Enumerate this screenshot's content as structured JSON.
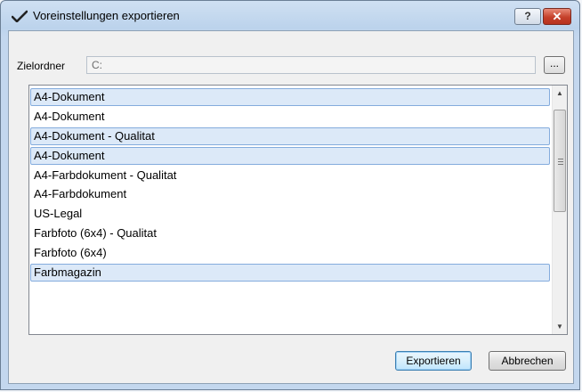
{
  "window": {
    "title": "Voreinstellungen exportieren",
    "help_label": "?",
    "close_label": "✕"
  },
  "folder": {
    "label": "Zielordner",
    "value": "C:",
    "browse_label": "..."
  },
  "presets": [
    {
      "label": "A4-Dokument",
      "selected": true
    },
    {
      "label": "A4-Dokument",
      "selected": false
    },
    {
      "label": "A4-Dokument - Qualitat",
      "selected": true
    },
    {
      "label": "A4-Dokument",
      "selected": true
    },
    {
      "label": "A4-Farbdokument - Qualitat",
      "selected": false
    },
    {
      "label": "A4-Farbdokument",
      "selected": false
    },
    {
      "label": "US-Legal",
      "selected": false
    },
    {
      "label": "Farbfoto (6x4) - Qualitat",
      "selected": false
    },
    {
      "label": "Farbfoto (6x4)",
      "selected": false
    },
    {
      "label": "Farbmagazin",
      "selected": true
    }
  ],
  "buttons": {
    "export": "Exportieren",
    "cancel": "Abbrechen"
  }
}
